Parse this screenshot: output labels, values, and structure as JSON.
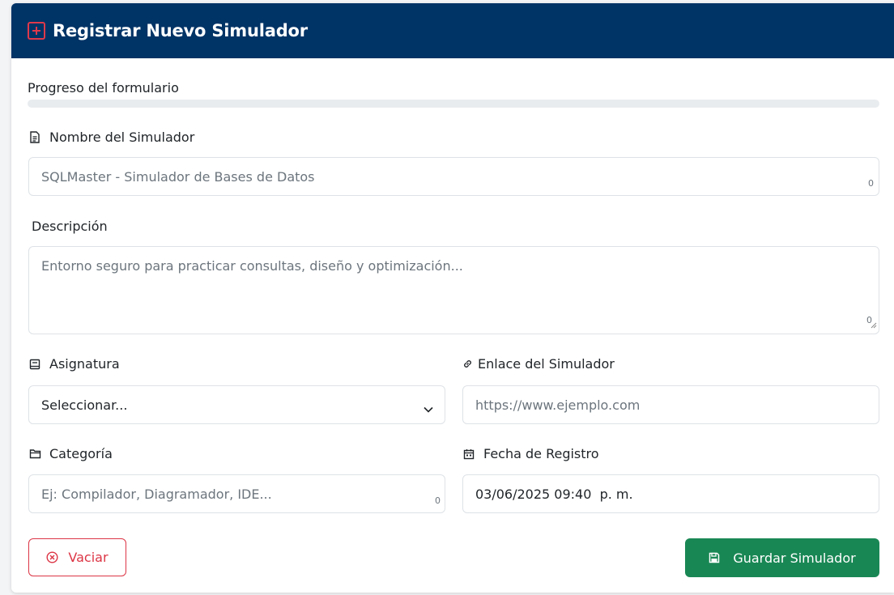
{
  "header": {
    "title": "Registrar Nuevo Simulador",
    "icon": "plus-square-icon",
    "background": "#003366",
    "icon_color": "#e0394b"
  },
  "progress": {
    "label": "Progreso del formulario",
    "percent": 0
  },
  "nombre": {
    "label": "Nombre del Simulador",
    "icon": "file-text-icon",
    "placeholder": "SQLMaster - Simulador de Bases de Datos",
    "counter": "0"
  },
  "descripcion": {
    "label": "Descripción",
    "placeholder": "Entorno seguro para practicar consultas, diseño y optimización...",
    "counter": "0"
  },
  "asignatura": {
    "label": "Asignatura",
    "icon": "book-icon",
    "selected": "Seleccionar..."
  },
  "enlace": {
    "label": "Enlace del Simulador",
    "icon": "link-icon",
    "placeholder": "https://www.ejemplo.com"
  },
  "categoria": {
    "label": "Categoría",
    "icon": "folder-icon",
    "placeholder": "Ej: Compilador, Diagramador, IDE...",
    "counter": "0"
  },
  "fecha": {
    "label": "Fecha de Registro",
    "icon": "calendar-icon",
    "value": "03/06/2025 09:40  p. m."
  },
  "buttons": {
    "clear_label": "Vaciar",
    "clear_icon": "x-circle-icon",
    "clear_color": "#dc3545",
    "save_label": "Guardar Simulador",
    "save_icon": "save-icon",
    "save_color": "#198754"
  }
}
